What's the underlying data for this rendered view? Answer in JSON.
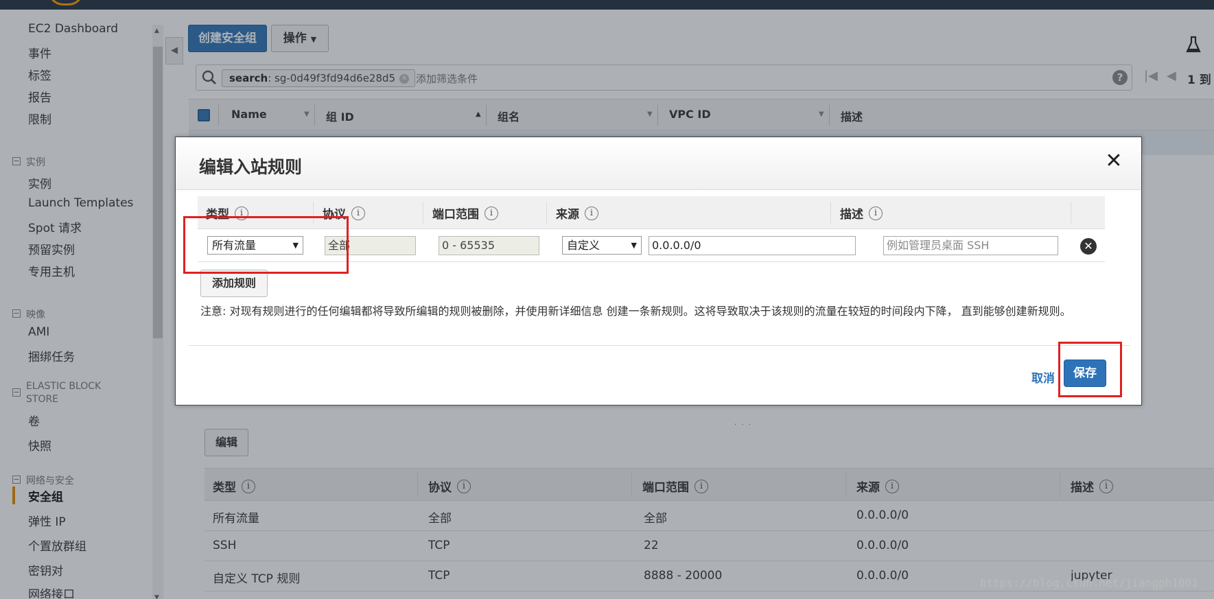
{
  "sidebar": {
    "items": [
      {
        "label": "EC2 Dashboard"
      },
      {
        "label": "事件"
      },
      {
        "label": "标签"
      },
      {
        "label": "报告"
      },
      {
        "label": "限制"
      },
      {
        "group": "实例"
      },
      {
        "label": "实例"
      },
      {
        "label": "Launch Templates"
      },
      {
        "label": "Spot 请求"
      },
      {
        "label": "预留实例"
      },
      {
        "label": "专用主机"
      },
      {
        "group": "映像"
      },
      {
        "label": "AMI"
      },
      {
        "label": "捆绑任务"
      },
      {
        "group": "ELASTIC BLOCK STORE"
      },
      {
        "label": "卷"
      },
      {
        "label": "快照"
      },
      {
        "group": "网络与安全"
      },
      {
        "label": "安全组"
      },
      {
        "label": "弹性 IP"
      },
      {
        "label": "个置放群组"
      },
      {
        "label": "密钥对"
      },
      {
        "label": "网络接口"
      }
    ]
  },
  "toolbar": {
    "create_label": "创建安全组",
    "actions_label": "操作"
  },
  "filter": {
    "token_key": "search",
    "token_value": ": sg-0d49f3fd94d6e28d5",
    "placeholder": "添加筛选条件"
  },
  "pager": {
    "text": "1 到"
  },
  "list": {
    "columns": [
      "Name",
      "组 ID",
      "组名",
      "VPC ID",
      "描述"
    ]
  },
  "modal": {
    "title": "编辑入站规则",
    "columns": [
      "类型",
      "协议",
      "端口范围",
      "来源",
      "描述"
    ],
    "rule": {
      "type": "所有流量",
      "protocol": "全部",
      "port_range": "0 - 65535",
      "source_type": "自定义",
      "source_value": "0.0.0.0/0",
      "description_placeholder": "例如管理员桌面 SSH"
    },
    "add_rule_label": "添加规则",
    "note": "注意: 对现有规则进行的任何编辑都将导致所编辑的规则被删除，并使用新详细信息 创建一条新规则。这将导致取决于该规则的流量在较短的时间段内下降， 直到能够创建新规则。",
    "cancel_label": "取消",
    "save_label": "保存"
  },
  "details": {
    "edit_label": "编辑",
    "columns": [
      "类型",
      "协议",
      "端口范围",
      "来源",
      "描述"
    ],
    "rows": [
      [
        "所有流量",
        "全部",
        "全部",
        "0.0.0.0/0",
        ""
      ],
      [
        "SSH",
        "TCP",
        "22",
        "0.0.0.0/0",
        ""
      ],
      [
        "自定义 TCP 规则",
        "TCP",
        "8888 - 20000",
        "0.0.0.0/0",
        "jupyter"
      ]
    ]
  },
  "watermark": "https://blog.csdn.net/jiangph1001",
  "colors": {
    "accent": "#2e73b8",
    "highlight": "#e02020",
    "active_nav": "#e88a00"
  }
}
